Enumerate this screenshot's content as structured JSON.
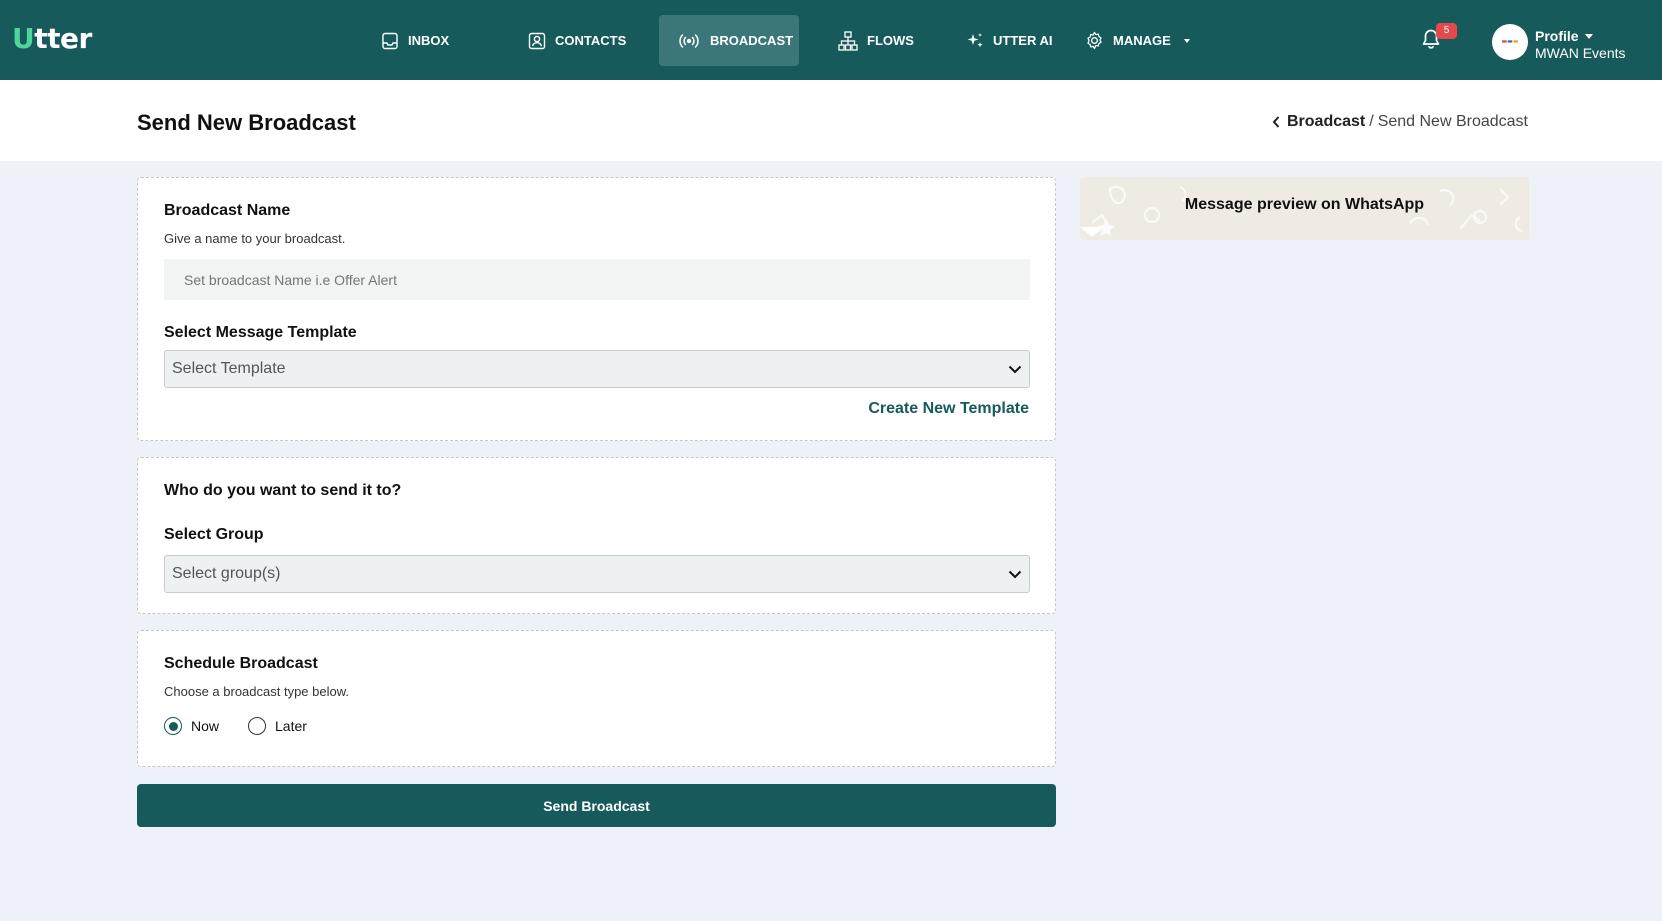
{
  "app": {
    "logo_u": "U",
    "logo_rest": "tter"
  },
  "nav": {
    "items": [
      {
        "label": "INBOX",
        "icon": "inbox-icon"
      },
      {
        "label": "CONTACTS",
        "icon": "contacts-icon"
      },
      {
        "label": "BROADCAST",
        "icon": "broadcast-icon",
        "active": true
      },
      {
        "label": "FLOWS",
        "icon": "flows-icon"
      },
      {
        "label": "UTTER AI",
        "icon": "sparkle-icon"
      },
      {
        "label": "MANAGE",
        "icon": "gear-icon",
        "has_dropdown": true
      }
    ],
    "notifications_count": "5",
    "profile_label": "Profile",
    "org_name": "MWAN Events"
  },
  "header": {
    "title": "Send New Broadcast",
    "breadcrumb_parent": "Broadcast",
    "breadcrumb_separator": "/",
    "breadcrumb_current": "Send New Broadcast"
  },
  "broadcast_card": {
    "name_heading": "Broadcast Name",
    "name_hint": "Give a name to your broadcast.",
    "name_placeholder": "Set broadcast Name i.e Offer Alert",
    "name_value": "",
    "template_heading": "Select Message Template",
    "template_selected": "Select Template",
    "create_template_link": "Create New Template"
  },
  "audience_card": {
    "question": "Who do you want to send it to?",
    "group_heading": "Select Group",
    "group_selected": "Select group(s)"
  },
  "schedule_card": {
    "heading": "Schedule Broadcast",
    "hint": "Choose a broadcast type below.",
    "options": [
      {
        "label": "Now",
        "selected": true
      },
      {
        "label": "Later",
        "selected": false
      }
    ]
  },
  "send_button": "Send Broadcast",
  "preview": {
    "title": "Message preview on WhatsApp"
  },
  "colors": {
    "brand": "#175a5c",
    "brand_active": "#3b7778",
    "logo_accent": "#4fd49b",
    "badge": "#e5484d",
    "page_bg": "#eef1f7"
  }
}
